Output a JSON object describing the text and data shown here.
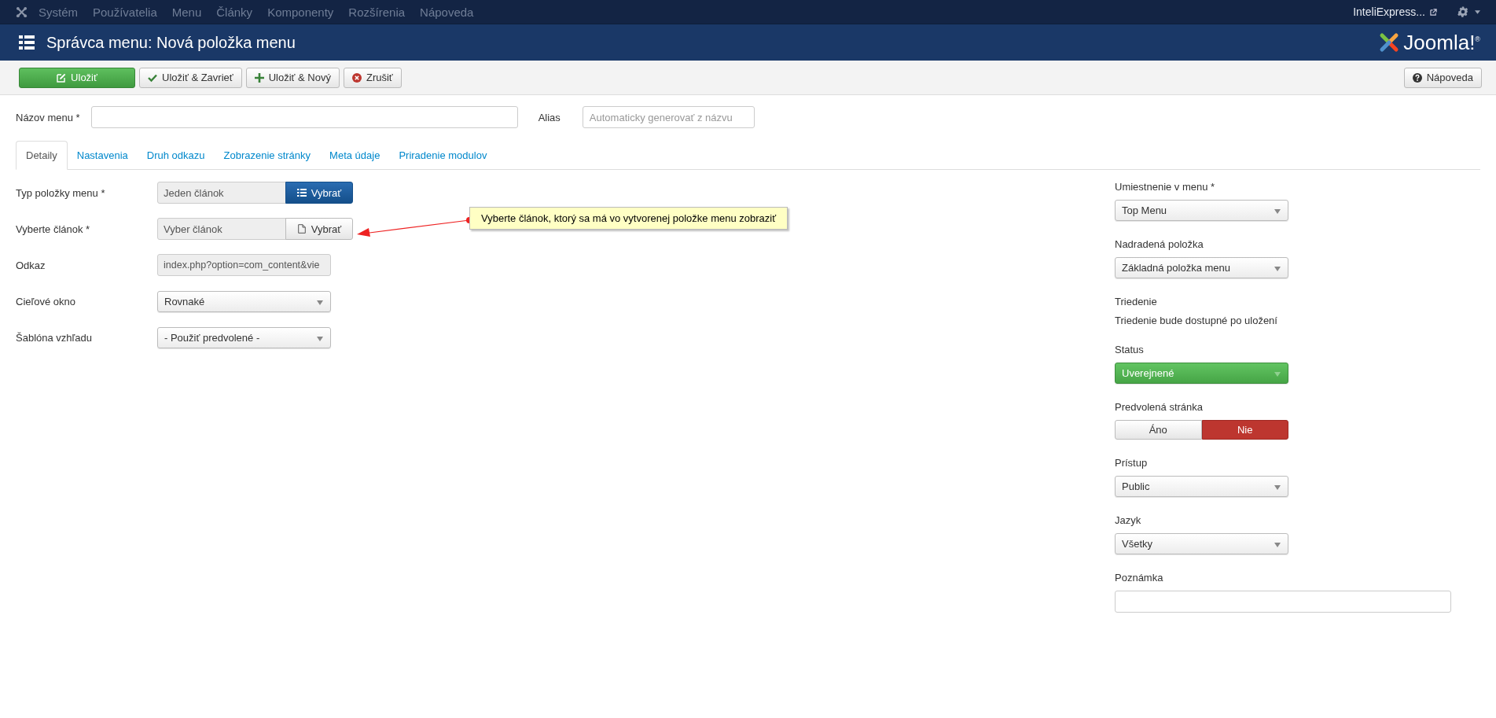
{
  "top_menu": {
    "items": [
      "Systém",
      "Používatelia",
      "Menu",
      "Články",
      "Komponenty",
      "Rozšírenia",
      "Nápoveda"
    ],
    "site_link": "InteliExpress..."
  },
  "header": {
    "title": "Správca menu: Nová položka menu",
    "logo": "Joomla!$^{®}$"
  },
  "toolbar": {
    "buttons": [
      {
        "kind": "save",
        "label": "Uložiť"
      },
      {
        "kind": "save_close",
        "label": "Uložiť & Zavrieť"
      },
      {
        "kind": "save_new",
        "label": "Uložiť & Nový"
      },
      {
        "kind": "cancel",
        "label": "Zrušiť"
      }
    ],
    "help": "Nápoveda"
  },
  "title_row": {
    "name_label": "Názov menu *",
    "alias_label": "Alias",
    "alias_placeholder": "Automaticky generovať z názvu"
  },
  "tabs": [
    {
      "label": "Detaily",
      "selected": true
    },
    {
      "label": "Nastavenia",
      "selected": false
    },
    {
      "label": "Druh odkazu",
      "selected": false
    },
    {
      "label": "Zobrazenie stránky",
      "selected": false
    },
    {
      "label": "Meta údaje",
      "selected": false
    },
    {
      "label": "Priradenie modulov",
      "selected": false
    }
  ],
  "left_fields": [
    {
      "kind": "picker",
      "label": "Typ položky menu *",
      "value": "Jeden článok",
      "button": "Vybrať",
      "primary": true
    },
    {
      "kind": "picker",
      "label": "Vyberte článok *",
      "value": "Vyber článok",
      "button": "Vybrať",
      "primary": false
    },
    {
      "kind": "readonly",
      "label": "Odkaz",
      "value": "index.php?option=com_content&vie"
    },
    {
      "kind": "select",
      "label": "Cieľové okno",
      "value": "Rovnaké"
    },
    {
      "kind": "select",
      "label": "Šablóna vzhľadu",
      "value": "- Použiť predvolené -"
    }
  ],
  "callout": "Vyberte článok, ktorý sa má vo vytvorenej položke menu zobraziť",
  "right_fields": [
    {
      "kind": "select",
      "label": "Umiestnenie v menu *",
      "value": "Top Menu"
    },
    {
      "kind": "select",
      "label": "Nadradená položka",
      "value": "Základná položka menu"
    },
    {
      "kind": "note",
      "label": "Triedenie",
      "value": "Triedenie bude dostupné po uložení"
    },
    {
      "kind": "status",
      "label": "Status",
      "value": "Uverejnené"
    },
    {
      "kind": "toggle",
      "label": "Predvolená stránka",
      "options": [
        {
          "label": "Áno",
          "selected": false
        },
        {
          "label": "Nie",
          "selected": true
        }
      ]
    },
    {
      "kind": "select",
      "label": "Prístup",
      "value": "Public"
    },
    {
      "kind": "select",
      "label": "Jazyk",
      "value": "Všetky"
    },
    {
      "kind": "textarea",
      "label": "Poznámka"
    }
  ]
}
